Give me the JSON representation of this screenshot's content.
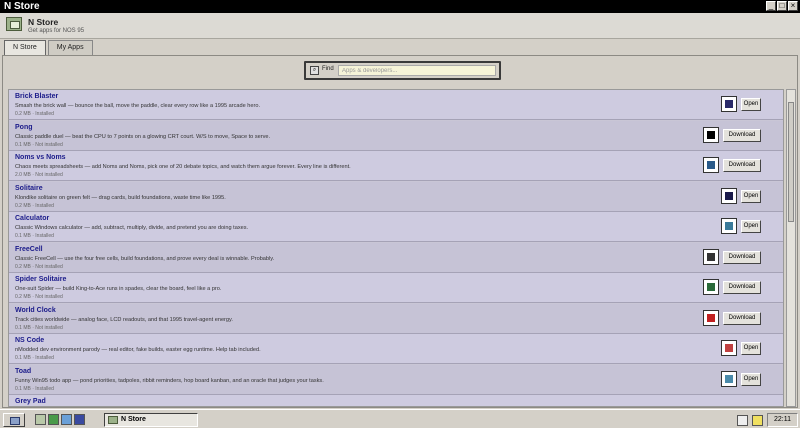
{
  "window": {
    "title": "N Store",
    "min_label": "_",
    "max_label": "□",
    "close_label": "×"
  },
  "header": {
    "title": "N Store",
    "subtitle": "Get apps for NOS 95"
  },
  "tabs": [
    {
      "label": "N Store",
      "active": true
    },
    {
      "label": "My Apps",
      "active": false
    }
  ],
  "search": {
    "label": "Find",
    "placeholder": "Apps & developers...",
    "value": ""
  },
  "apps": [
    {
      "name": "Brick Blaster",
      "desc": "Smash the brick wall — bounce the ball, move the paddle, clear every row like a 1995 arcade hero.",
      "meta": "0.2 MB · Installed",
      "action": "Open",
      "icon": "brick-icon",
      "icon_color": "#2a2a6a"
    },
    {
      "name": "Pong",
      "desc": "Classic paddle duel — beat the CPU to 7 points on a glowing CRT court. W/S to move, Space to serve.",
      "meta": "0.1 MB · Not installed",
      "action": "Download",
      "icon": "pong-icon",
      "icon_color": "#000000"
    },
    {
      "name": "Noms vs Noms",
      "desc": "Chaos meets spreadsheets — add Noms and Noms, pick one of 20 debate topics, and watch them argue forever. Every line is different.",
      "meta": "2.0 MB · Not installed",
      "action": "Download",
      "icon": "noms-icon",
      "icon_color": "#2a5a8a"
    },
    {
      "name": "Solitaire",
      "desc": "Klondike solitaire on green felt — drag cards, build foundations, waste time like 1995.",
      "meta": "0.2 MB · Installed",
      "action": "Open",
      "icon": "cards-icon",
      "icon_color": "#1a1a4a"
    },
    {
      "name": "Calculator",
      "desc": "Classic Windows calculator — add, subtract, multiply, divide, and pretend you are doing taxes.",
      "meta": "0.1 MB · Installed",
      "action": "Open",
      "icon": "calculator-icon",
      "icon_color": "#3a7a9a"
    },
    {
      "name": "FreeCell",
      "desc": "Classic FreeCell — use the four free cells, build foundations, and prove every deal is winnable. Probably.",
      "meta": "0.2 MB · Not installed",
      "action": "Download",
      "icon": "freecell-icon",
      "icon_color": "#333333"
    },
    {
      "name": "Spider Solitaire",
      "desc": "One-suit Spider — build King-to-Ace runs in spades, clear the board, feel like a pro.",
      "meta": "0.2 MB · Not installed",
      "action": "Download",
      "icon": "spider-icon",
      "icon_color": "#2a6a3a"
    },
    {
      "name": "World Clock",
      "desc": "Track cities worldwide — analog face, LCD readouts, and that 1995 travel-agent energy.",
      "meta": "0.1 MB · Not installed",
      "action": "Download",
      "icon": "clock-icon",
      "icon_color": "#c02020"
    },
    {
      "name": "NS Code",
      "desc": "nModded dev environment parody — real editor, fake builds, easter egg runtime. Help tab included.",
      "meta": "0.1 MB · Installed",
      "action": "Open",
      "icon": "code-icon",
      "icon_color": "#c04040"
    },
    {
      "name": "Toad",
      "desc": "Funny Win95 todo app — pond priorities, tadpoles, ribbit reminders, hop board kanban, and an oracle that judges your tasks.",
      "meta": "0.1 MB · Installed",
      "action": "Open",
      "icon": "toad-icon",
      "icon_color": "#4a8aaa"
    },
    {
      "name": "Grey Pad",
      "desc": "",
      "meta": "",
      "action": "",
      "icon": "",
      "icon_color": "#888888"
    }
  ],
  "taskbar": {
    "app_label": "N Store",
    "clock": "22:11"
  }
}
